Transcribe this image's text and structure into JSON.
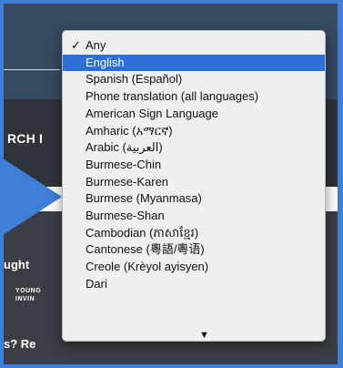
{
  "background": {
    "search_button_fragment": "RCH I",
    "side_text_fragment": "ught",
    "logo_lines": [
      "YOUNG",
      "INVIN"
    ],
    "bottom_text_fragment": "s? Re"
  },
  "dropdown": {
    "checked_index": 0,
    "highlighted_index": 1,
    "options": [
      "Any",
      "English",
      "Spanish (Español)",
      "Phone translation (all languages)",
      "American Sign Language",
      "Amharic (አማርኛ)",
      "Arabic (العربية)",
      "Burmese-Chin",
      "Burmese-Karen",
      "Burmese (Myanmasa)",
      "Burmese-Shan",
      "Cambodian (ភាសាខ្មែរ)",
      "Cantonese (粵語/粵语)",
      "Creole (Krèyol ayisyen)",
      "Dari"
    ],
    "checkmark": "✓",
    "scroll_down_icon": "▼"
  },
  "colors": {
    "highlight": "#2f6fdc",
    "arrow": "#3f7fd7"
  }
}
